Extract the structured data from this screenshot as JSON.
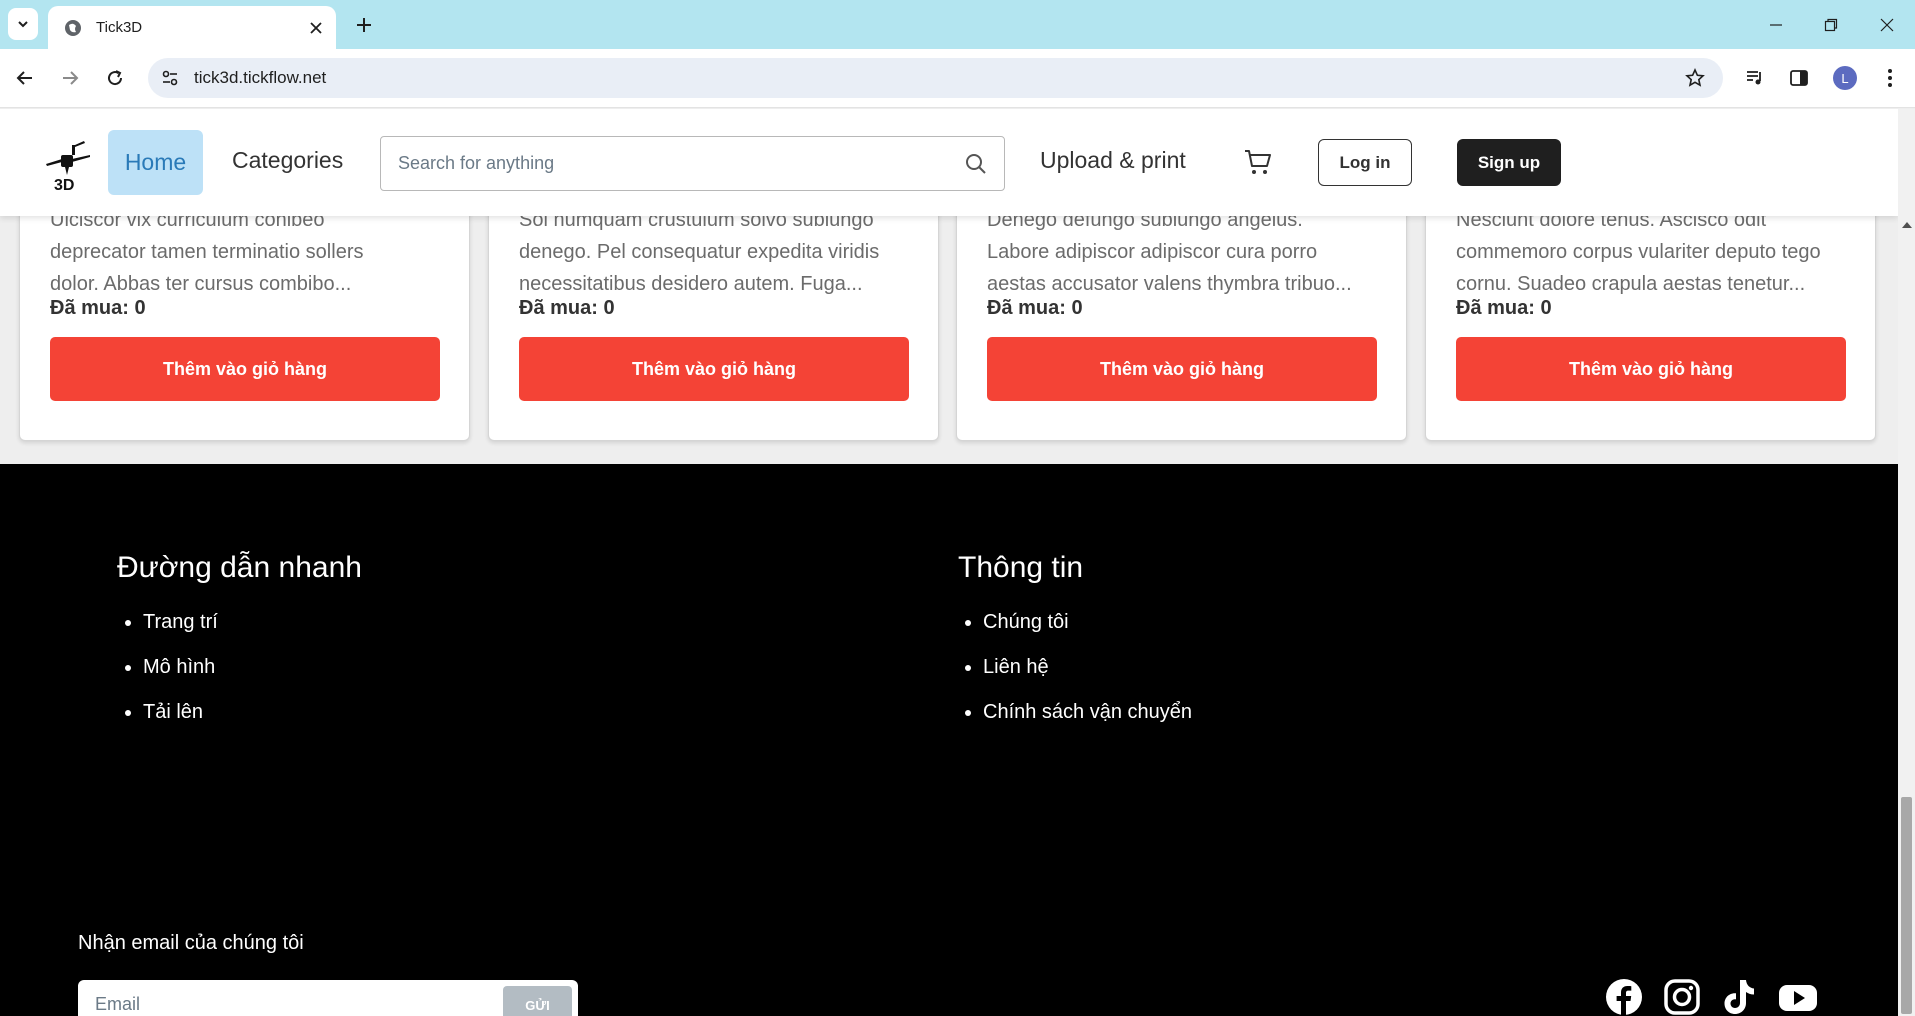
{
  "browser": {
    "tab_title": "Tick3D",
    "url": "tick3d.tickflow.net",
    "profile_initial": "L"
  },
  "header": {
    "home_label": "Home",
    "categories_label": "Categories",
    "search_placeholder": "Search for anything",
    "upload_label": "Upload & print",
    "login_label": "Log in",
    "signup_label": "Sign up"
  },
  "products": [
    {
      "desc_lines": [
        "Ulciscor vix curriculum conibeo",
        "deprecator tamen terminatio sollers",
        "dolor. Abbas ter cursus combibo..."
      ],
      "bought": "Đã mua: 0",
      "button": "Thêm vào giỏ hàng"
    },
    {
      "desc_lines": [
        "Soi numquam crustulum solvo sublungo",
        "denego. Pel consequatur expedita viridis",
        "necessitatibus desidero autem. Fuga..."
      ],
      "bought": "Đã mua: 0",
      "button": "Thêm vào giỏ hàng"
    },
    {
      "desc_lines": [
        "Denego defungo sublungo angelus.",
        "Labore adipiscor adipiscor cura porro",
        "aestas accusator valens thymbra tribuo..."
      ],
      "bought": "Đã mua: 0",
      "button": "Thêm vào giỏ hàng"
    },
    {
      "desc_lines": [
        "Nesciunt dolore tenus. Ascisco odit",
        "commemoro corpus vulariter deputo tego",
        "cornu. Suadeo crapula aestas tenetur..."
      ],
      "bought": "Đã mua: 0",
      "button": "Thêm vào giỏ hàng"
    }
  ],
  "footer": {
    "quick_links": {
      "title": "Đường dẫn nhanh",
      "items": [
        "Trang trí",
        "Mô hình",
        "Tải lên"
      ]
    },
    "info": {
      "title": "Thông tin",
      "items": [
        "Chúng tôi",
        "Liên hệ",
        "Chính sách vận chuyển"
      ]
    },
    "newsletter": {
      "label": "Nhận email của chúng tôi",
      "placeholder": "Email",
      "button": "GỬI"
    },
    "social_icons": [
      "facebook-icon",
      "instagram-icon",
      "tiktok-icon",
      "youtube-icon"
    ]
  },
  "colors": {
    "accent_red": "#f44336",
    "home_bg": "#bde1f7",
    "footer_bg": "#000000"
  }
}
